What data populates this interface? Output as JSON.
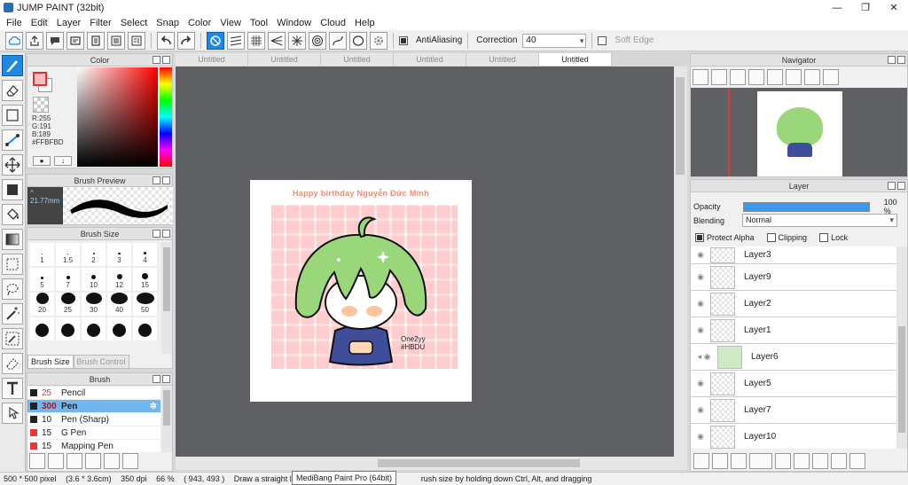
{
  "window": {
    "title": "JUMP PAINT (32bit)",
    "minimize": "—",
    "maximize": "❐",
    "close": "✕"
  },
  "menu": [
    "File",
    "Edit",
    "Layer",
    "Filter",
    "Select",
    "Snap",
    "Color",
    "View",
    "Tool",
    "Window",
    "Cloud",
    "Help"
  ],
  "toolbar": {
    "antialiasing_label": "AntiAliasing",
    "correction_label": "Correction",
    "correction_value": "40",
    "soft_edge_label": "Soft Edge"
  },
  "color_panel": {
    "title": "Color",
    "r": "R:255",
    "g": "G:191",
    "b": "B:189",
    "hex": "#FFBFBD",
    "btn1": "●",
    "btn2": "↓",
    "colors": {
      "foreground": "#FFBFBD",
      "accent": "#1E88E5"
    }
  },
  "brush_preview": {
    "title": "Brush Preview",
    "size": "^ 21.77mm"
  },
  "brush_size": {
    "title": "Brush Size",
    "sizes": [
      "1",
      "1.5",
      "2",
      "3",
      "4",
      "5",
      "7",
      "10",
      "12",
      "15",
      "20",
      "25",
      "30",
      "40",
      "50",
      "",
      "",
      "",
      "",
      ""
    ],
    "tab_size": "Brush Size",
    "tab_control": "Brush Control"
  },
  "brush_panel": {
    "title": "Brush",
    "items": [
      {
        "size": "25",
        "name": "Pencil",
        "color": "#222222"
      },
      {
        "size": "300",
        "name": "Pen",
        "color": "#222222"
      },
      {
        "size": "10",
        "name": "Pen (Sharp)",
        "color": "#222222"
      },
      {
        "size": "15",
        "name": "G Pen",
        "color": "#e53935"
      },
      {
        "size": "15",
        "name": "Mapping Pen",
        "color": "#e53935"
      }
    ]
  },
  "documents": {
    "tabs": [
      "Untitled",
      "Untitled",
      "Untitled",
      "Untitled",
      "Untitled",
      "Untitled"
    ]
  },
  "canvas": {
    "title": "Happy birthday Nguyễn Đức Minh",
    "signature_line1": "One2yy",
    "signature_line2": "#HBDU"
  },
  "navigator": {
    "title": "Navigator"
  },
  "layer_panel": {
    "title": "Layer",
    "opacity_label": "Opacity",
    "opacity_value": "100 %",
    "opacity_level": 1.0,
    "blending_label": "Blending",
    "blending_value": "Normal",
    "protect_alpha": "Protect Alpha",
    "clipping": "Clipping",
    "lock": "Lock",
    "layers": [
      "Layer3",
      "Layer9",
      "Layer2",
      "Layer1",
      "Layer6",
      "Layer5",
      "Layer7",
      "Layer10"
    ]
  },
  "status": {
    "size": "500 * 500 pixel",
    "physical": "(3.6 * 3.6cm)",
    "dpi": "350 dpi",
    "zoom": "66 %",
    "coords": "( 943, 493 )",
    "hint_left": "Draw a straight line by h",
    "hint_right": "rush size by holding down Ctrl, Alt, and dragging",
    "tooltip": "MediBang Paint Pro (64bit)"
  }
}
